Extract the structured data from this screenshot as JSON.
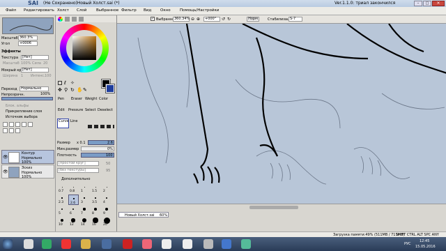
{
  "window": {
    "title": "(Не Сохранено)Новый Холст.sai (*)",
    "version": "Ver.1.1.0: триал закончился",
    "app_logo": "SAI"
  },
  "menu": [
    "Файл",
    "Редактировать",
    "Холст",
    "Слой",
    "Выбранное",
    "Фильтр",
    "Вид",
    "Окно",
    "Помощь/Настройки"
  ],
  "navigator": {
    "scale_label": "Масштаб",
    "scale_value": "360.3%",
    "angle_label": "Угол",
    "angle_value": "+0006"
  },
  "effects": {
    "title": "Эффекты",
    "texture_label": "Текстура",
    "texture_value": "[Нет]",
    "scale_label": "Масштаб",
    "scale_val": "100%",
    "strength_label": "Сила",
    "strength_val": "20",
    "edge_label": "Мокрый край",
    "edge_value": "[Нет]",
    "width_label": "Ширина",
    "width_val": "1",
    "intensity_label": "Интенс.",
    "intensity_val": "100"
  },
  "layer_props": {
    "mode_label": "Переход",
    "mode_value": "Нормально",
    "opacity_label": "Непрозрачн.",
    "opacity_value": "100%",
    "chk_protect": "Блок. альфы",
    "chk_clip": "Прикрепление слоя",
    "chk_source": "Источник выбора"
  },
  "layers": [
    {
      "name": "Контур",
      "mode": "Нормально",
      "opacity": "100%",
      "selected": true
    },
    {
      "name": "Эскиз",
      "mode": "Нормально",
      "opacity": "100%",
      "selected": false
    }
  ],
  "toolbar": {
    "checkbox_label": "Выбранное",
    "zoom": "360.34%",
    "angle": "+000°",
    "mode": "Норм",
    "stab_label": "Стабилизация",
    "stab_value": "S-7"
  },
  "tools": {
    "row1": [
      "Pen",
      "Eraser",
      "Weight",
      "Color"
    ],
    "row2": [
      "Edit",
      "Pressure",
      "Select",
      "Deselect"
    ],
    "row3": [
      "Curve",
      "Line"
    ]
  },
  "brush": {
    "size_label": "Размер",
    "size_mult": "x 0.1",
    "size_value": "2.6",
    "min_size_label": "Мин.размер",
    "min_size_value": "0%",
    "density_label": "Плотность",
    "density_value": "100",
    "shape_value": "[простой круг]",
    "shape_num": "50",
    "texture_value": "[без текстуры]",
    "texture_num": "95",
    "advanced_label": "Дополнительно",
    "sizes": [
      "0.7",
      "0.8",
      "1",
      "1.5",
      "2",
      "2.3",
      "2.6",
      "3",
      "3.5",
      "4",
      "5",
      "6",
      "7",
      "8",
      "9",
      "10",
      "12",
      "14",
      "16",
      "20"
    ]
  },
  "doc_tab": {
    "name": "Новый Холст.sai",
    "zoom": "60%"
  },
  "status": {
    "memory": "Загрузка памяти:49% (511MB / 711MB)",
    "keys": "SHIFT CTRL ALT SPC ANY"
  },
  "taskbar": {
    "lang": "РУС",
    "time": "12:45",
    "date": "15.05.2016"
  },
  "colors": {
    "primary": "#000000",
    "secondary": "#1f3d9c"
  }
}
